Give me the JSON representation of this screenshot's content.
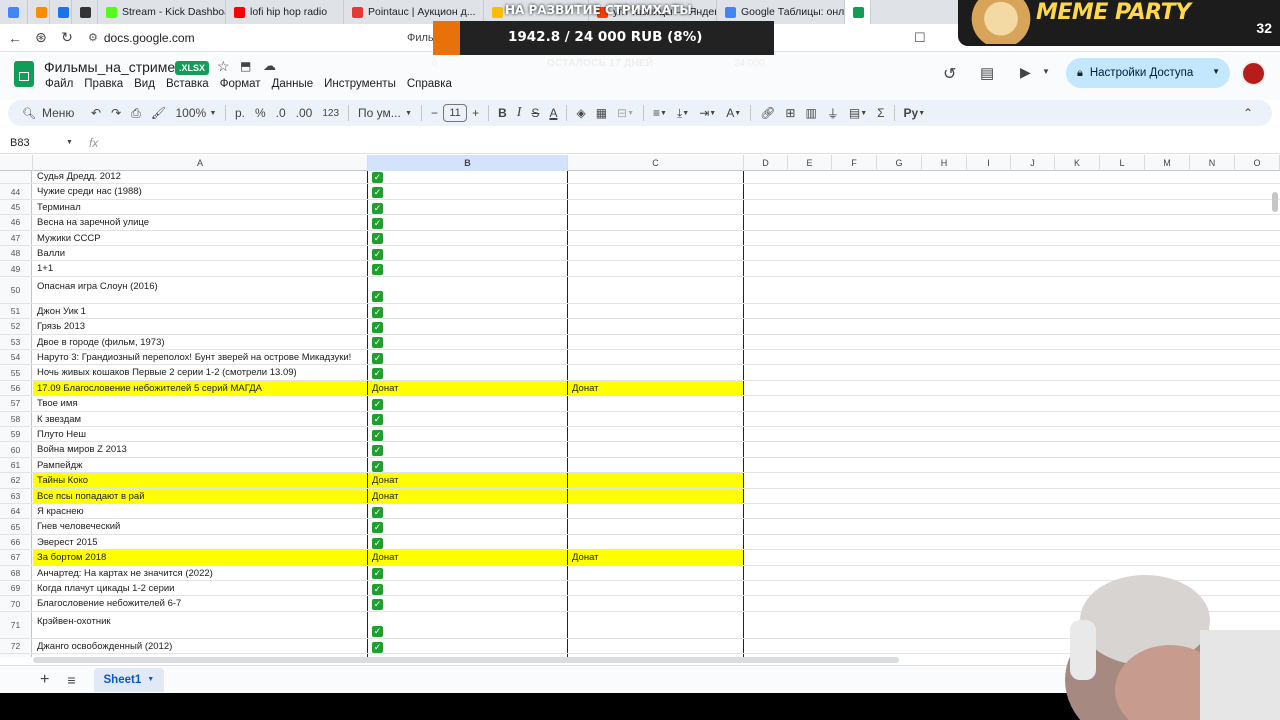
{
  "browser": {
    "tabs": [
      {
        "label": "",
        "color": "#4285f4"
      },
      {
        "label": "",
        "color": "#fb8c00"
      },
      {
        "label": "",
        "color": "#1a73e8"
      },
      {
        "label": "",
        "color": "#333333"
      },
      {
        "label": "Stream - Kick Dashboard",
        "color": "#53fc18"
      },
      {
        "label": "lofi hip hop radio",
        "color": "#ff0000"
      },
      {
        "label": "Pointauc | Аукцион д...",
        "color": "#e53935"
      },
      {
        "label": "",
        "color": "#fbbc04"
      },
      {
        "label": "угл таблицы — Яндекс.",
        "color": "#ff3d00"
      },
      {
        "label": "Google Таблицы: онлайн",
        "color": "#4285f4"
      },
      {
        "label": "",
        "color": "#0f9d58"
      }
    ],
    "url": "docs.google.com",
    "url_title": "Филь"
  },
  "doc": {
    "title": "Фильмы_на_стриме",
    "badge": ".XLSX",
    "menu": [
      "Файл",
      "Правка",
      "Вид",
      "Вставка",
      "Формат",
      "Данные",
      "Инструменты",
      "Справка"
    ],
    "share_label": "Настройки Доступа"
  },
  "toolbar": {
    "menu_label": "Меню",
    "zoom": "100%",
    "currency": "р.",
    "percent": "%",
    "dec_dec": ".0",
    "dec_inc": ".00",
    "numfmt": "123",
    "font": "По ум...",
    "font_size": "11",
    "bold": "B",
    "italic": "I",
    "strike": "S",
    "underline_a": "A"
  },
  "formula": {
    "cell_ref": "B83",
    "fx": "fx",
    "value": ""
  },
  "columns": [
    "A",
    "B",
    "C",
    "D",
    "E",
    "F",
    "G",
    "H",
    "I",
    "J",
    "K",
    "L",
    "M",
    "N",
    "O"
  ],
  "rows": [
    {
      "n": "",
      "a": "Судья Дредд. 2012",
      "b": "",
      "c": "",
      "check": true,
      "hl": false,
      "tall": false
    },
    {
      "n": "44",
      "a": "Чужие среди нас (1988)",
      "b": "",
      "c": "",
      "check": true,
      "hl": false,
      "tall": false
    },
    {
      "n": "45",
      "a": "Терминал",
      "b": "",
      "c": "",
      "check": true,
      "hl": false,
      "tall": false
    },
    {
      "n": "46",
      "a": "Весна на заречной улице",
      "b": "",
      "c": "",
      "check": true,
      "hl": false,
      "tall": false
    },
    {
      "n": "47",
      "a": "Мужики СССР",
      "b": "",
      "c": "",
      "check": true,
      "hl": false,
      "tall": false
    },
    {
      "n": "48",
      "a": "Валли",
      "b": "",
      "c": "",
      "check": true,
      "hl": false,
      "tall": false
    },
    {
      "n": "49",
      "a": "1+1",
      "b": "",
      "c": "",
      "check": true,
      "hl": false,
      "tall": false
    },
    {
      "n": "50",
      "a": "Опасная игра Слоун (2016)",
      "b": "",
      "c": "",
      "check": true,
      "hl": false,
      "tall": true
    },
    {
      "n": "51",
      "a": "Джон Уик 1",
      "b": "",
      "c": "",
      "check": true,
      "hl": false,
      "tall": false
    },
    {
      "n": "52",
      "a": "Грязь 2013",
      "b": "",
      "c": "",
      "check": true,
      "hl": false,
      "tall": false
    },
    {
      "n": "53",
      "a": "Двое в городе (фильм, 1973)",
      "b": "",
      "c": "",
      "check": true,
      "hl": false,
      "tall": false
    },
    {
      "n": "54",
      "a": "Наруто 3: Грандиозный переполох! Бунт зверей на острове Микадзуки!",
      "b": "",
      "c": "",
      "check": true,
      "hl": false,
      "tall": false
    },
    {
      "n": "55",
      "a": "Ночь живых кошаков Первые 2 серии 1-2 (смотрели 13.09)",
      "b": "",
      "c": "",
      "check": true,
      "hl": false,
      "tall": false
    },
    {
      "n": "56",
      "a": "17.09  Благословение небожителей 5 серий МАГДА",
      "b": "Донат",
      "c": "Донат",
      "check": false,
      "hl": true,
      "tall": false
    },
    {
      "n": "57",
      "a": "Твое имя",
      "b": "",
      "c": "",
      "check": true,
      "hl": false,
      "tall": false
    },
    {
      "n": "58",
      "a": "К звездам",
      "b": "",
      "c": "",
      "check": true,
      "hl": false,
      "tall": false
    },
    {
      "n": "59",
      "a": "Плуто Неш",
      "b": "",
      "c": "",
      "check": true,
      "hl": false,
      "tall": false
    },
    {
      "n": "60",
      "a": "Война миров Z 2013",
      "b": "",
      "c": "",
      "check": true,
      "hl": false,
      "tall": false
    },
    {
      "n": "61",
      "a": "Рампейдж",
      "b": "",
      "c": "",
      "check": true,
      "hl": false,
      "tall": false
    },
    {
      "n": "62",
      "a": "Тайны Коко",
      "b": "Донат",
      "c": "",
      "check": false,
      "hl": true,
      "tall": false
    },
    {
      "n": "63",
      "a": "Все псы попадают в рай",
      "b": "Донат",
      "c": "",
      "check": false,
      "hl": true,
      "tall": false
    },
    {
      "n": "64",
      "a": "Я краснею",
      "b": "",
      "c": "",
      "check": true,
      "hl": false,
      "tall": false
    },
    {
      "n": "65",
      "a": "Гнев человеческий",
      "b": "",
      "c": "",
      "check": true,
      "hl": false,
      "tall": false
    },
    {
      "n": "66",
      "a": "Эверест 2015",
      "b": "",
      "c": "",
      "check": true,
      "hl": false,
      "tall": false
    },
    {
      "n": "67",
      "a": "За бортом 2018",
      "b": "Донат",
      "c": "Донат",
      "check": false,
      "hl": true,
      "tall": false
    },
    {
      "n": "68",
      "a": "Анчартед: На картах не значится (2022)",
      "b": "",
      "c": "",
      "check": true,
      "hl": false,
      "tall": false
    },
    {
      "n": "69",
      "a": "Когда плачут цикады 1-2 серии",
      "b": "",
      "c": "",
      "check": true,
      "hl": false,
      "tall": false
    },
    {
      "n": "70",
      "a": "Благословение небожителей 6-7",
      "b": "",
      "c": "",
      "check": true,
      "hl": false,
      "tall": false
    },
    {
      "n": "71",
      "a": "Крэйвен-охотник",
      "b": "",
      "c": "",
      "check": true,
      "hl": false,
      "tall": true
    },
    {
      "n": "72",
      "a": "Джанго освобожденный (2012)",
      "b": "",
      "c": "",
      "check": true,
      "hl": false,
      "tall": false
    },
    {
      "n": "73",
      "a": "",
      "b": "",
      "c": "",
      "check": true,
      "hl": false,
      "tall": false
    }
  ],
  "sheet": {
    "tab_label": "Sheet1"
  },
  "overlay": {
    "heading": "НА РАЗВИТИЕ СТРИМХАТЫ",
    "amount": "1942.8 / 24 000 RUB (8%)",
    "progress": 0.08,
    "min": "0",
    "remaining": "ОСТАЛОСЬ 17 ДНЕЙ",
    "max": "24 000"
  },
  "meme": {
    "title": "MEME PARTY",
    "count": "32"
  },
  "colors": {
    "highlight": "#ffff00",
    "check": "#1fa02e",
    "accent": "#e8710a",
    "sheets_green": "#0f9d58"
  }
}
